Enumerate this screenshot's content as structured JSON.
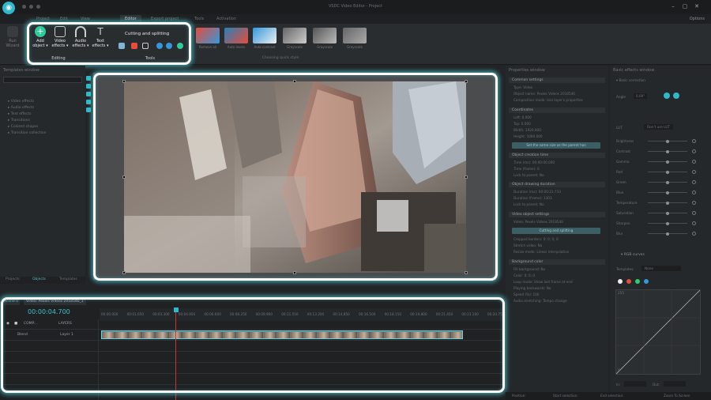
{
  "window": {
    "title": "VSDC Video Editor - Project",
    "logo_glyph": "◉"
  },
  "menu": {
    "tabs": [
      {
        "label": "Project"
      },
      {
        "label": "Edit"
      },
      {
        "label": "View"
      },
      {
        "label": "Editor"
      },
      {
        "label": "Export project"
      },
      {
        "label": "Tools"
      },
      {
        "label": "Activation"
      }
    ],
    "active_tab": "Editor",
    "options_label": "Options"
  },
  "ribbon": {
    "run_wizard_label": "Run Wizard",
    "editing": {
      "group_label": "Editing",
      "buttons": [
        {
          "label": "Add object",
          "icon": "add-icon",
          "color": "#2ecc9a"
        },
        {
          "label": "Video effects",
          "icon": "video-effects-icon",
          "color": "#c9ccd0"
        },
        {
          "label": "Audio effects",
          "icon": "headphones-icon",
          "color": "#c9ccd0"
        },
        {
          "label": "Text effects",
          "icon": "text-icon",
          "color": "#c9ccd0"
        }
      ]
    },
    "tools": {
      "group_label": "Tools",
      "cutting_label": "Cutting and splitting"
    },
    "quick_styles": {
      "group_label": "Choosing quick style",
      "items": [
        {
          "label": "Remove all"
        },
        {
          "label": "Auto levels"
        },
        {
          "label": "Auto contrast"
        },
        {
          "label": "Grayscale"
        },
        {
          "label": "Grayscale"
        },
        {
          "label": "Grayscale"
        }
      ]
    }
  },
  "left_panel": {
    "title": "Templates window",
    "tree": [
      "Video effects",
      "Audio effects",
      "Text effects",
      "Transitions",
      "Colored shapes",
      "Transition collection"
    ],
    "tabs": [
      "Projects",
      "Objects",
      "Templates"
    ]
  },
  "properties": {
    "title": "Properties window",
    "sections": [
      {
        "label": "Common settings",
        "rows": [
          "Type: Video",
          "Object name: Pexels Videos 2018546",
          "Composition mode: Use layer's properties"
        ]
      },
      {
        "label": "Coordinates",
        "rows": [
          "Left: 0.000",
          "Top: 0.000",
          "Width: 1920.000",
          "Height: 1080.000"
        ]
      },
      {
        "label": "Object creation time",
        "rows": [
          "Time (ms): 00:00:00.000",
          "Time (frame): 0",
          "Lock to parent: No"
        ]
      },
      {
        "label": "Object drawing duration",
        "rows": [
          "Duration (ms): 00:00:21.733",
          "Duration (frame): 1303",
          "Lock to parent: No"
        ]
      },
      {
        "label": "Video object settings",
        "rows": [
          "Video: Pexels Videos 2018546",
          "Cutting and splitting"
        ]
      },
      {
        "label": "Background color",
        "rows": [
          "Fill background: No",
          "Color: 0; 0; 0",
          "Loop mode: Show last frame at end",
          "Playing backwards: No",
          "Speed (%): 100",
          "Audio stretching: Tempo change"
        ]
      }
    ],
    "buttons": [
      "Set the same size as the parent has",
      "Cutting and splitting"
    ],
    "misc_rows": [
      "Cropped borders: 0; 0; 0; 0",
      "Stretch video: No",
      "Resize mode: Linear interpolation"
    ]
  },
  "effects": {
    "title": "Basic effects window",
    "section_color": "Basic correction",
    "angle_label": "Angle",
    "angle_value": "0.00°",
    "lut_label": "LUT",
    "lut_value": "Don't use LUT",
    "sliders": [
      {
        "label": "Brightness",
        "value": 0.5
      },
      {
        "label": "Contrast",
        "value": 0.5
      },
      {
        "label": "Gamma",
        "value": 0.5
      },
      {
        "label": "Red",
        "value": 0.5
      },
      {
        "label": "Green",
        "value": 0.5
      },
      {
        "label": "Blue",
        "value": 0.5
      },
      {
        "label": "Temperature",
        "value": 0.5
      },
      {
        "label": "Saturation",
        "value": 0.5
      },
      {
        "label": "Sharpen",
        "value": 0.5
      },
      {
        "label": "Blur",
        "value": 0.5
      }
    ],
    "rgb_section": "RGB curves",
    "templates_label": "Templates:",
    "templates_value": "None",
    "curve_top": "255",
    "curve_bottom": "0",
    "in_label": "In:",
    "out_label": "Out:",
    "curve_colors": [
      "#eeeeee",
      "#e74c3c",
      "#2ecc71",
      "#3498db"
    ]
  },
  "timeline": {
    "scene_tab": "Scene 0",
    "video_tab": "Video: Pexels Videos 2018546_1",
    "current_time": "00:00:04.700",
    "ticks": [
      "00:00:000",
      "00:01.650",
      "00:03.300",
      "00:04.950",
      "00:06.600",
      "00:08.250",
      "00:09.900",
      "00:11.550",
      "00:13.200",
      "00:14.850",
      "00:16.500",
      "00:18.150",
      "00:19.800",
      "00:21.450",
      "00:23.100",
      "00:24.75"
    ],
    "layer_header": "COMP...",
    "layers_label": "LAYERS",
    "blend_label": "Blend",
    "layer_name": "Layer 1"
  },
  "status": {
    "position": "Position:",
    "start": "Start selection:",
    "end": "End selection:",
    "zoom": "Zoom To Screen"
  }
}
